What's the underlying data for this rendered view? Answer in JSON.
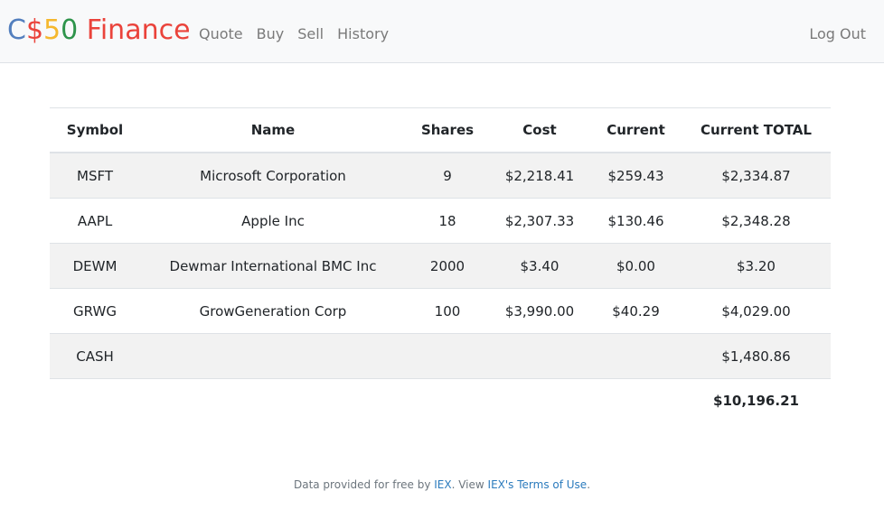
{
  "brand": {
    "part1": "C",
    "part2": "$",
    "part3": "5",
    "part4": "0",
    "part5": " Finance",
    "colors": [
      "#537fbe",
      "#ea433b",
      "#f5b82e",
      "#2e944b",
      "#ea433b"
    ]
  },
  "nav": {
    "items": [
      {
        "label": "Quote"
      },
      {
        "label": "Buy"
      },
      {
        "label": "Sell"
      },
      {
        "label": "History"
      }
    ],
    "logout": "Log Out"
  },
  "table": {
    "headers": [
      "Symbol",
      "Name",
      "Shares",
      "Cost",
      "Current",
      "Current TOTAL"
    ],
    "rows": [
      {
        "symbol": "MSFT",
        "name": "Microsoft Corporation",
        "shares": "9",
        "cost": "$2,218.41",
        "current": "$259.43",
        "total": "$2,334.87"
      },
      {
        "symbol": "AAPL",
        "name": "Apple Inc",
        "shares": "18",
        "cost": "$2,307.33",
        "current": "$130.46",
        "total": "$2,348.28"
      },
      {
        "symbol": "DEWM",
        "name": "Dewmar International BMC Inc",
        "shares": "2000",
        "cost": "$3.40",
        "current": "$0.00",
        "total": "$3.20"
      },
      {
        "symbol": "GRWG",
        "name": "GrowGeneration Corp",
        "shares": "100",
        "cost": "$3,990.00",
        "current": "$40.29",
        "total": "$4,029.00"
      },
      {
        "symbol": "CASH",
        "name": "",
        "shares": "",
        "cost": "",
        "current": "",
        "total": "$1,480.86"
      }
    ],
    "grand_total": "$10,196.21"
  },
  "footer": {
    "prefix": "Data provided for free by ",
    "link1": "IEX",
    "middle": ". View ",
    "link2": "IEX's Terms of Use",
    "suffix": "."
  }
}
